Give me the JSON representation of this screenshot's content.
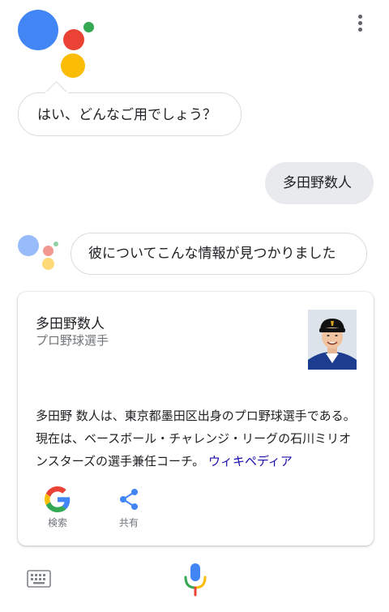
{
  "assistant_greeting": "はい、どんなご用でしょう？",
  "user_query": "多田野数人",
  "assistant_reply": "彼についてこんな情報が見つかりました",
  "card": {
    "title": "多田野数人",
    "subtitle": "プロ野球選手",
    "description": "多田野 数人は、東京都墨田区出身のプロ野球選手である。現在は、ベースボール・チャレンジ・リーグの石川ミリオンスターズの選手兼任コーチ。",
    "source_link": "ウィキペディア",
    "actions": {
      "search_label": "検索",
      "share_label": "共有"
    }
  },
  "icons": {
    "menu": "more-vert-icon",
    "keyboard": "keyboard-icon",
    "mic": "mic-icon",
    "search": "google-g-icon",
    "share": "share-icon"
  },
  "colors": {
    "google_blue": "#4285f4",
    "google_red": "#ea4335",
    "google_yellow": "#fbbc05",
    "google_green": "#34a853",
    "link": "#1a0dab"
  }
}
